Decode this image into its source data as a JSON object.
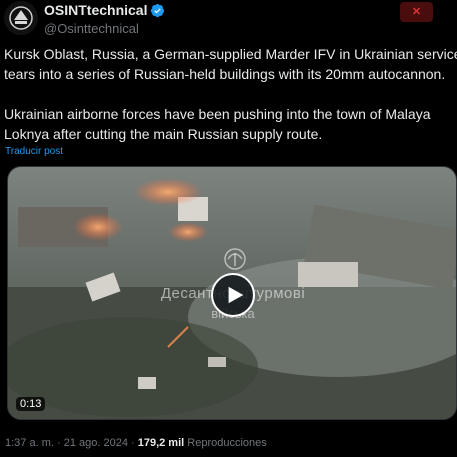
{
  "author": {
    "display_name": "OSINTtechnical",
    "handle": "@Osinttechnical",
    "verified_icon": "verified-badge-icon",
    "avatar_icon": "avatar-logo-icon"
  },
  "more_button": {
    "label": "✕",
    "icon": "close-icon",
    "color": "#dd3333"
  },
  "tweet": {
    "line1": "Kursk Oblast, Russia, a German-supplied Marder IFV in Ukrainian service",
    "line2": "tears into a series of Russian-held buildings with its 20mm autocannon.",
    "line3": "Ukrainian airborne forces have been pushing into the town of Malaya",
    "line4": "Loknya after cutting the main Russian supply route."
  },
  "translate_link": "Traducir post",
  "media": {
    "watermark_line1": "Десантно-штурмові",
    "watermark_line2": "війська",
    "duration": "0:13",
    "play_icon": "play-icon"
  },
  "meta": {
    "time": "1:37 a. m.",
    "separator": " · ",
    "date": "21 ago. 2024",
    "views_count": "179,2 mil",
    "views_label": "Reproducciones"
  },
  "colors": {
    "background": "#000000",
    "text": "#e7e9ea",
    "muted": "#71767b",
    "link": "#1d9bf0",
    "verified": "#1d9bf0"
  }
}
